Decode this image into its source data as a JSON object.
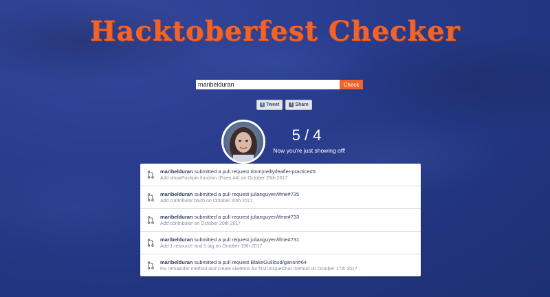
{
  "title": "Hacktoberfest Checker",
  "search": {
    "value": "maribelduran",
    "button_label": "Check"
  },
  "share": {
    "tweet_label": "Tweet",
    "share_label": "Share"
  },
  "progress": {
    "count_text": "5 / 4",
    "message": "Now you're just showing off!"
  },
  "pull_requests": [
    {
      "user": "maribelduran",
      "action": "submitted a pull request",
      "repo": "timmyreilly/leaflet-practice#5",
      "description": "Add showPushpin function (Fixes #4)",
      "date_text": "on October 26th 2017"
    },
    {
      "user": "maribelduran",
      "action": "submitted a pull request",
      "repo": "julianguyen/ifme#735",
      "description": "Add contributor blurb",
      "date_text": "on October 20th 2017"
    },
    {
      "user": "maribelduran",
      "action": "submitted a pull request",
      "repo": "julianguyen/ifme#733",
      "description": "Add contributor",
      "date_text": "on October 20th 2017"
    },
    {
      "user": "maribelduran",
      "action": "submitted a pull request",
      "repo": "julianguyen/ifme#731",
      "description": "Add 1 resource and 1 tag",
      "date_text": "on October 19th 2017"
    },
    {
      "user": "maribelduran",
      "action": "submitted a pull request",
      "repo": "BlakeGuilloud/ganon#64",
      "description": "Fix remainder method and create skeleton for firstUniqueChar method",
      "date_text": "on October 17th 2017"
    }
  ],
  "colors": {
    "accent": "#f0632a",
    "background": "#2a3d8f"
  }
}
